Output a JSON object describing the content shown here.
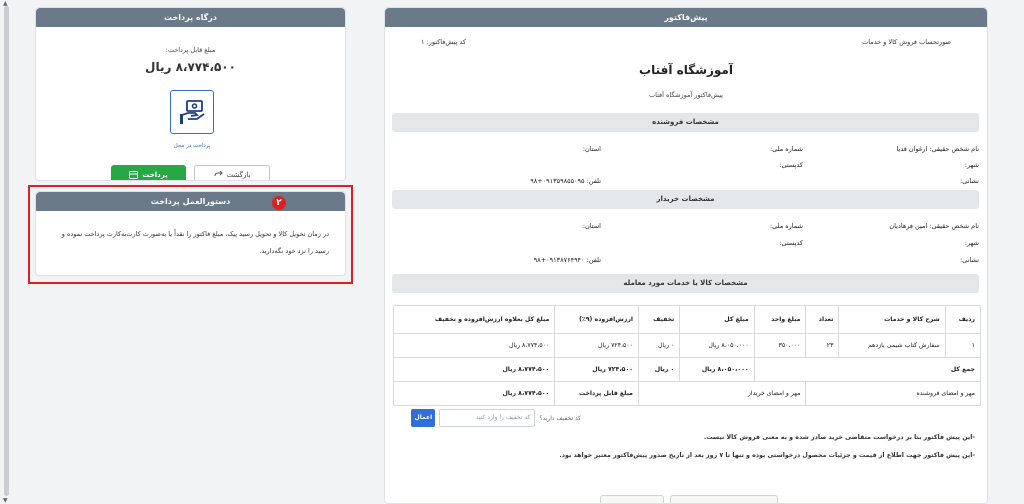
{
  "invoice": {
    "header": "پیش‌فاکتور",
    "account_type": "صورتحساب فروش کالا و خدمات",
    "invoice_code": "کد پیش‌فاکتور: ۱",
    "shop_name": "آموزشگاه آفتاب",
    "subtitle": "پیش‌فاکتور آموزشگاه آفتاب",
    "seller": {
      "section_title": "مشخصات فروشنده",
      "name": "نام شخص حقیقی: ارغوان قدیا",
      "national_id": "شماره ملی:",
      "province": "استان:",
      "city": "شهر:",
      "postal_code": "کدپستی:",
      "address": "نشانی:",
      "phone": "تلفن: ۰۹۱۳۵۹۸۵۵۰۹۵+۹۸"
    },
    "buyer": {
      "section_title": "مشخصات خریدار",
      "name": "نام شخص حقیقی: امین فرهادیان",
      "national_id": "شماره ملی:",
      "province": "استان:",
      "city": "شهر:",
      "postal_code": "کدپستی:",
      "address": "نشانی:",
      "phone": "تلفن: ۰۹۱۳۸۷۶۴۹۴۰+۹۸"
    },
    "items_section_title": "مشخصات کالا یا خدمات مورد معامله",
    "table": {
      "headers": [
        "ردیف",
        "شرح کالا و خدمات",
        "تعداد",
        "مبلغ واحد",
        "مبلغ کل",
        "تخفیف",
        "ارزش‌افزوده (۹٪)",
        "مبلغ کل بعلاوه ارزش‌افزوده و تخفیف"
      ],
      "rows": [
        [
          "۱",
          "سفارش کتاب شیمی یازدهم",
          "۲۳",
          "۳۵۰،۰۰۰",
          "۸،۰۵۰،۰۰۰ ریال",
          "۰ ریال",
          "۷۲۴،۵۰۰ ریال",
          "۸،۷۷۴،۵۰۰ ریال"
        ]
      ],
      "total_label": "جمع کل",
      "total_amount": "۸،۰۵۰،۰۰۰ ریال",
      "total_discount": "۰ ریال",
      "total_vat": "۷۲۴،۵۰۰ ریال",
      "total_final": "۸،۷۷۴،۵۰۰ ریال",
      "seller_stamp": "مهر و امضای فروشنده",
      "buyer_stamp": "مهر و امضای خریدار",
      "payable_label": "مبلغ قابل پرداخت",
      "payable_amount": "۸،۷۷۴،۵۰۰ ریال"
    },
    "discount": {
      "label": "کد تخفیف دارید؟",
      "placeholder": "کد تخفیف را وارد کنید",
      "apply_label": "اعمال"
    },
    "notes": [
      "-این پیش فاکتور بنا بر درخواست متقاضی خرید صادر شده و به معنی فروش کالا نیست.",
      "-این پیش فاکتور جهت اطلاع از قیمت و جزئیات محصول درخواستی بوده و تنها تا ۷ روز بعد از تاریخ صدور پیش‌فاکتور معتبر خواهد بود."
    ]
  },
  "gateway": {
    "header": "درگاه پرداخت",
    "amount_label": "مبلغ قابل پرداخت:",
    "amount": "۸،۷۷۴،۵۰۰ ریال",
    "option_label": "پرداخت در محل",
    "pay_label": "پرداخت",
    "back_label": "بازگشت"
  },
  "instructions": {
    "header": "دستورالعمل پرداخت",
    "text": "در زمان تحویل کالا و تحویل رسید پیک، مبلغ فاکتور را نقداً یا به‌صورت کارت‌به‌کارت پرداخت نموده و رسید را نزد خود نگه‌دارید.",
    "badge": "۲"
  },
  "colors": {
    "header": "#6b7a89",
    "pay": "#27a845",
    "accent": "#2f6fd6",
    "highlight": "#e02020"
  }
}
